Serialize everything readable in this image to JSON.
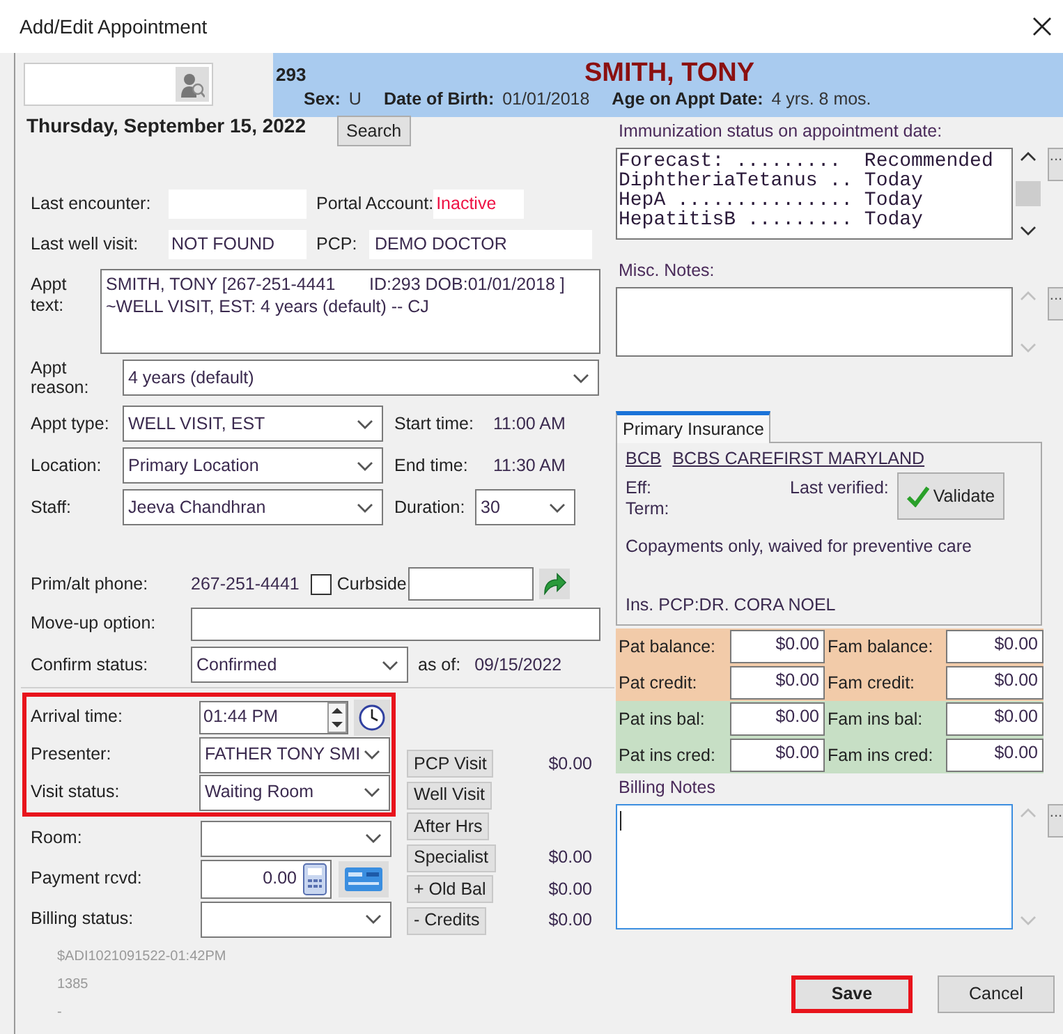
{
  "window": {
    "title": "Add/Edit Appointment"
  },
  "patient_header": {
    "id": "293",
    "name": "SMITH, TONY",
    "fields": [
      {
        "label": "Sex:",
        "value": "U"
      },
      {
        "label": "Date of Birth:",
        "value": "01/01/2018"
      },
      {
        "label": "Age on Appt Date:",
        "value": "4 yrs. 8 mos."
      }
    ]
  },
  "appointment_date": "Thursday, September 15, 2022",
  "search_button": "Search",
  "last_encounter": {
    "label": "Last encounter:"
  },
  "portal_account": {
    "label": "Portal Account:",
    "value": "Inactive",
    "inactive": true
  },
  "last_well_visit": {
    "label": "Last well visit:",
    "value": "NOT FOUND"
  },
  "pcp": {
    "label": "PCP:",
    "value": "DEMO DOCTOR"
  },
  "appt_text": {
    "label": "Appt text:",
    "value": "SMITH, TONY [267-251-4441       ID:293 DOB:01/01/2018 ] ~WELL VISIT, EST: 4 years (default) -- CJ"
  },
  "appt_reason": {
    "label": "Appt reason:",
    "value": "4 years (default)"
  },
  "appt_fields": [
    {
      "label": "Appt type:",
      "value": "WELL VISIT, EST",
      "side_label": "Start time:",
      "side_value": "11:00 AM",
      "kind": "text"
    },
    {
      "label": "Location:",
      "value": "Primary Location",
      "side_label": "End time:",
      "side_value": "11:30 AM",
      "kind": "text"
    },
    {
      "label": "Staff:",
      "value": "Jeeva Chandhran",
      "side_label": "Duration:",
      "side_value": "30",
      "kind": "select"
    }
  ],
  "phone": {
    "label": "Prim/alt phone:",
    "value": "267-251-4441",
    "curbside": {
      "label": "Curbside",
      "checked": false
    }
  },
  "move_up": {
    "label": "Move-up option:"
  },
  "confirm_status": {
    "label": "Confirm status:",
    "value": "Confirmed",
    "as_of_label": "as of:",
    "as_of": "09/15/2022"
  },
  "visit_fields": {
    "highlighted": true,
    "rows": [
      {
        "kind": "time",
        "label": "Arrival time:",
        "value": "01:44 PM"
      },
      {
        "kind": "select",
        "label": "Presenter:",
        "value": "FATHER TONY SMI"
      },
      {
        "kind": "select",
        "label": "Visit status:",
        "value": "Waiting Room"
      }
    ]
  },
  "billing_fields": [
    {
      "kind": "select",
      "label": "Room:"
    },
    {
      "kind": "payment",
      "label": "Payment rcvd:",
      "value": "0.00"
    },
    {
      "kind": "select",
      "label": "Billing status:"
    }
  ],
  "charges": [
    {
      "label": "PCP Visit",
      "amount": "$0.00"
    },
    {
      "label": "Well Visit"
    },
    {
      "label": "After Hrs"
    },
    {
      "label": "Specialist",
      "amount": "$0.00"
    },
    {
      "label": "+ Old Bal",
      "amount": "$0.00"
    },
    {
      "label": "- Credits",
      "amount": "$0.00"
    }
  ],
  "footnotes": [
    "$ADI1021091522-01:42PM",
    "1385",
    "-"
  ],
  "immunization": {
    "label": "Immunization status on appointment date:",
    "lines": [
      "Forecast: .........  Recommended",
      "DiphtheriaTetanus .. Today",
      "HepA ............... Today",
      "HepatitisB ......... Today"
    ],
    "scrollable": true,
    "more_button": "..."
  },
  "misc_notes": {
    "label": "Misc. Notes:",
    "scrollable": false,
    "more_button": "..."
  },
  "insurance": {
    "tabs": [
      {
        "label": "Primary Insurance",
        "selected": true
      }
    ],
    "code": "BCB",
    "carrier": "BCBS CAREFIRST MARYLAND",
    "eff_label": "Eff:",
    "term_label": "Term:",
    "verified_label": "Last verified:",
    "validate_button": "Validate",
    "coverage": "Copayments only, waived for preventive care",
    "pcp_label": "Ins. PCP:",
    "pcp": "DR. CORA NOEL"
  },
  "balances": [
    {
      "label": "Pat balance:",
      "value": "$0.00",
      "color": "#f2cba9"
    },
    {
      "label": "Fam balance:",
      "value": "$0.00",
      "color": "#f2cba9"
    },
    {
      "label": "Pat credit:",
      "value": "$0.00",
      "color": "#f2cba9"
    },
    {
      "label": "Fam credit:",
      "value": "$0.00",
      "color": "#f2cba9"
    },
    {
      "label": "Pat ins bal:",
      "value": "$0.00",
      "color": "#c7dfc5"
    },
    {
      "label": "Fam ins bal:",
      "value": "$0.00",
      "color": "#c7dfc5"
    },
    {
      "label": "Pat ins cred:",
      "value": "$0.00",
      "color": "#c7dfc5"
    },
    {
      "label": "Fam ins cred:",
      "value": "$0.00",
      "color": "#c7dfc5"
    }
  ],
  "billing_notes": {
    "label": "Billing Notes",
    "scrollable": false,
    "focused": true,
    "more_button": "..."
  },
  "buttons": [
    {
      "label": "Save",
      "highlighted": true
    },
    {
      "label": "Cancel",
      "highlighted": false
    }
  ]
}
